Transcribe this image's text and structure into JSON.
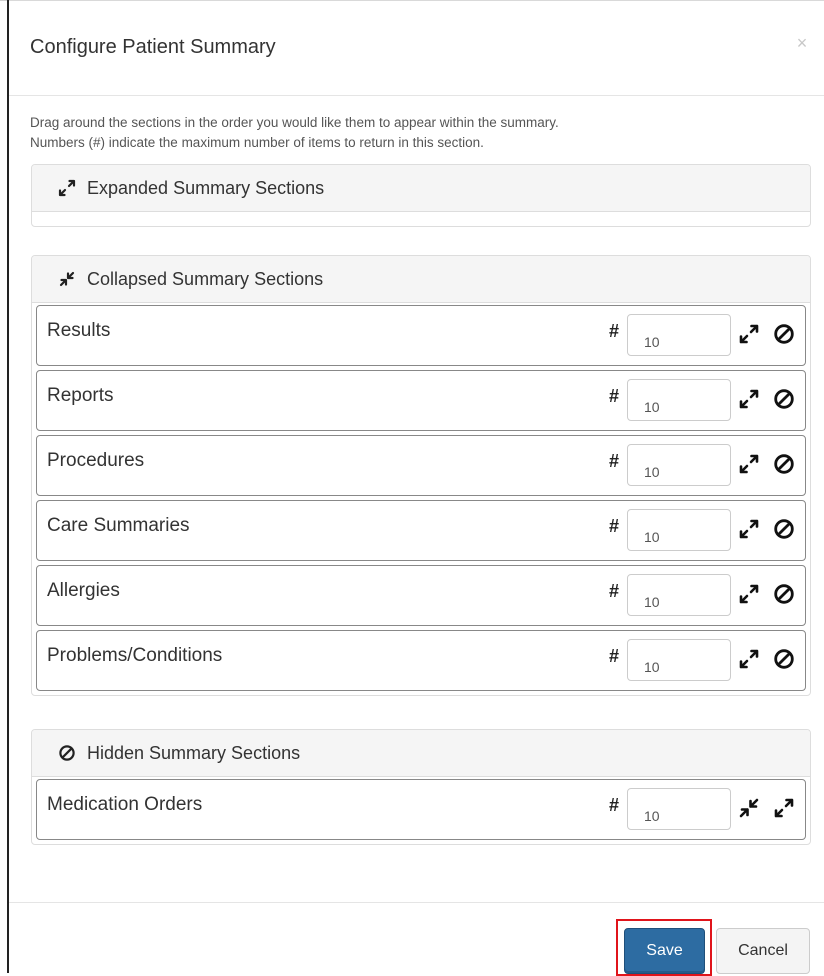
{
  "dialog": {
    "title": "Configure Patient Summary",
    "close_icon": "close-icon",
    "instructions_line1": "Drag around the sections in the order you would like them to appear within the summary.",
    "instructions_line2": "Numbers (#) indicate the maximum number of items to return in this section."
  },
  "expanded": {
    "heading": "Expanded Summary Sections",
    "icon": "expand-icon",
    "items": []
  },
  "collapsed": {
    "heading": "Collapsed Summary Sections",
    "icon": "collapse-icon",
    "items": [
      {
        "label": "Results",
        "count": "10"
      },
      {
        "label": "Reports",
        "count": "10"
      },
      {
        "label": "Procedures",
        "count": "10"
      },
      {
        "label": "Care Summaries",
        "count": "10"
      },
      {
        "label": "Allergies",
        "count": "10"
      },
      {
        "label": "Problems/Conditions",
        "count": "10"
      }
    ]
  },
  "hidden": {
    "heading": "Hidden Summary Sections",
    "icon": "hide-icon",
    "items": [
      {
        "label": "Medication Orders",
        "count": "10"
      }
    ]
  },
  "count_symbol": "#",
  "footer": {
    "save_label": "Save",
    "cancel_label": "Cancel"
  },
  "colors": {
    "primary": "#2d6ca2",
    "highlight": "#e0141b",
    "panel_heading_bg": "#f5f5f5"
  }
}
